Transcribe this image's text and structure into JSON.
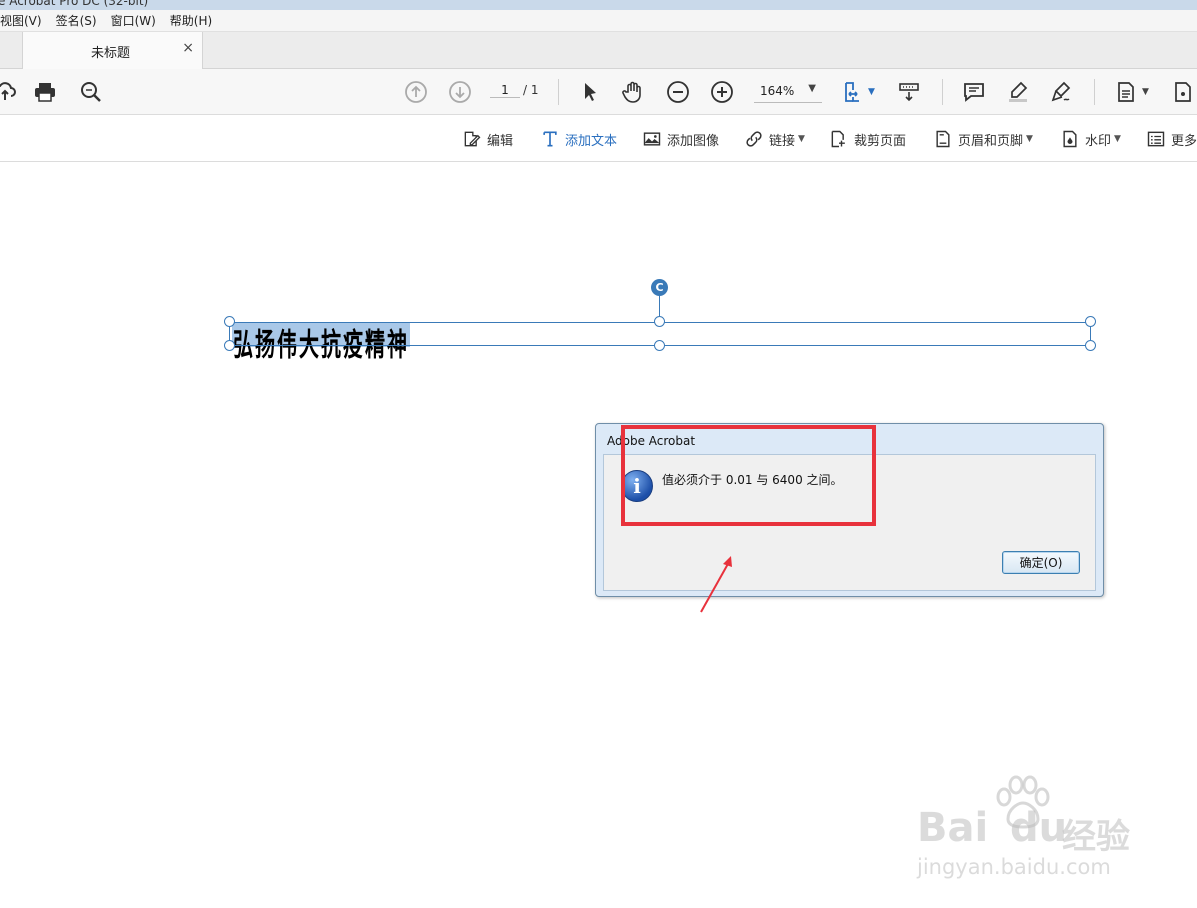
{
  "window": {
    "title": "e Acrobat Pro DC (32-bit)"
  },
  "menubar": {
    "items": [
      "视图(V)",
      "签名(S)",
      "窗口(W)",
      "帮助(H)"
    ]
  },
  "tab": {
    "title": "未标题",
    "close": "×"
  },
  "toolbar": {
    "page_current": "1",
    "page_total": "/ 1",
    "zoom": "164%",
    "icons": [
      "cloud-upload-icon",
      "print-icon",
      "zoom-search-icon",
      "page-up-icon",
      "page-down-icon",
      "select-arrow-icon",
      "hand-icon",
      "zoom-out-icon",
      "zoom-in-icon",
      "fit-page-icon",
      "scroll-mode-icon",
      "comment-icon",
      "highlight-icon",
      "sign-icon",
      "page-icon",
      "page-icon-2"
    ]
  },
  "edit_toolbar": {
    "edit": "编辑",
    "add_text": "添加文本",
    "add_image": "添加图像",
    "link": "链接",
    "crop": "裁剪页面",
    "header_footer": "页眉和页脚",
    "watermark": "水印",
    "more": "更多"
  },
  "document": {
    "selected_text": "弘扬伟大抗疫精神",
    "rotate_glyph": "C"
  },
  "dialog": {
    "title": "Adobe Acrobat",
    "message": "值必须介于 0.01 与 6400 之间。",
    "ok": "确定(O)",
    "info_glyph": "i"
  },
  "watermark": {
    "brand": "Bai",
    "brand2": "du",
    "cn": "经验",
    "url": "jingyan.baidu.com"
  },
  "colors": {
    "accent": "#2a6fbf",
    "selection": "#a9c8e8",
    "annotation_red": "#e8323c",
    "handle_blue": "#3a7ab8"
  }
}
